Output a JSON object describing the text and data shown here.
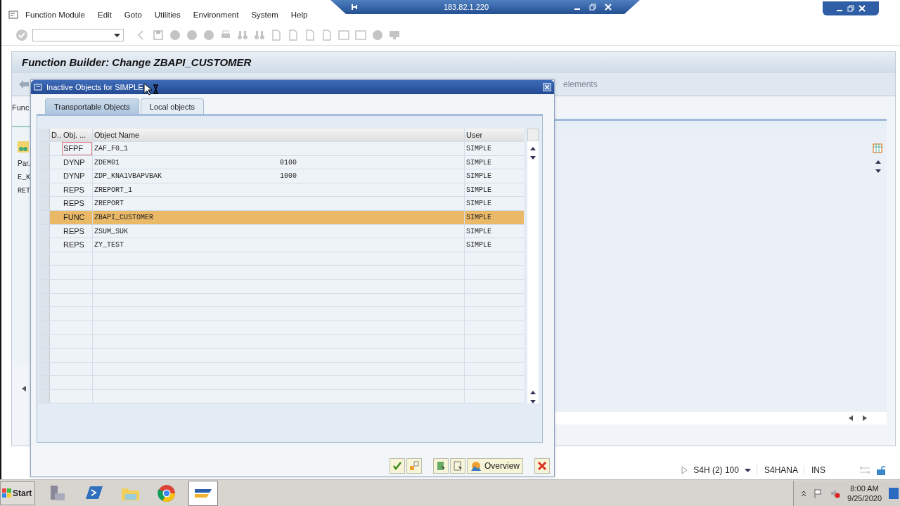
{
  "remote_bar": {
    "address": "183.82.1.220"
  },
  "menu_bar": [
    "Function Module",
    "Edit",
    "Goto",
    "Utilities",
    "Environment",
    "System",
    "Help"
  ],
  "screen_title": "Function Builder: Change ZBAPI_CUSTOMER",
  "background": {
    "left_labels": [
      "Par.",
      "E_K",
      "RET"
    ],
    "screen_label": "Func",
    "toolbar_fragment": "elements"
  },
  "dialog": {
    "title": "Inactive Objects for SIMPLE",
    "tabs": [
      {
        "label": "Transportable Objects",
        "selected": true
      },
      {
        "label": "Local objects",
        "selected": false
      }
    ],
    "table": {
      "columns": [
        "D..",
        "Obj. ...",
        "Object Name",
        "",
        "User"
      ],
      "rows": [
        {
          "type": "SFPF",
          "name": "ZAF_F0_1",
          "user": "SIMPLE",
          "selected": false,
          "focused": true
        },
        {
          "type": "DYNP",
          "name": "ZDEM01",
          "column_4": "0100",
          "user": "SIMPLE",
          "selected": false,
          "focused": false
        },
        {
          "type": "DYNP",
          "name": "ZDP_KNA1VBAPVBAK",
          "column_4": "1000",
          "user": "SIMPLE",
          "selected": false,
          "focused": false
        },
        {
          "type": "REPS",
          "name": "ZREPORT_1",
          "user": "SIMPLE",
          "selected": false,
          "focused": false
        },
        {
          "type": "REPS",
          "name": "ZREPORT",
          "user": "SIMPLE",
          "selected": false,
          "focused": false
        },
        {
          "type": "FUNC",
          "name": "ZBAPI_CUSTOMER",
          "user": "SIMPLE",
          "selected": true,
          "focused": false
        },
        {
          "type": "REPS",
          "name": "ZSUM_SUK",
          "user": "SIMPLE",
          "selected": false,
          "focused": false
        },
        {
          "type": "REPS",
          "name": "ZY_TEST",
          "user": "SIMPLE",
          "selected": false,
          "focused": false
        }
      ]
    },
    "buttons": [
      {
        "kind": "confirm"
      },
      {
        "kind": "transfer"
      },
      {
        "kind": "select"
      },
      {
        "kind": "deselect"
      },
      {
        "kind": "overview",
        "label": "Overview"
      },
      {
        "kind": "cancel"
      }
    ]
  },
  "status_bar": {
    "system": "S4H (2) 100",
    "server": "S4HANA",
    "mode": "INS"
  },
  "taskbar": {
    "start": "Start",
    "apps": [
      {
        "kind": "server",
        "selected": false
      },
      {
        "kind": "shell",
        "selected": false
      },
      {
        "kind": "folder",
        "selected": false
      },
      {
        "kind": "browser",
        "selected": false
      },
      {
        "kind": "sap",
        "selected": true
      }
    ],
    "time": "8:00 AM",
    "date": "9/25/2020"
  }
}
